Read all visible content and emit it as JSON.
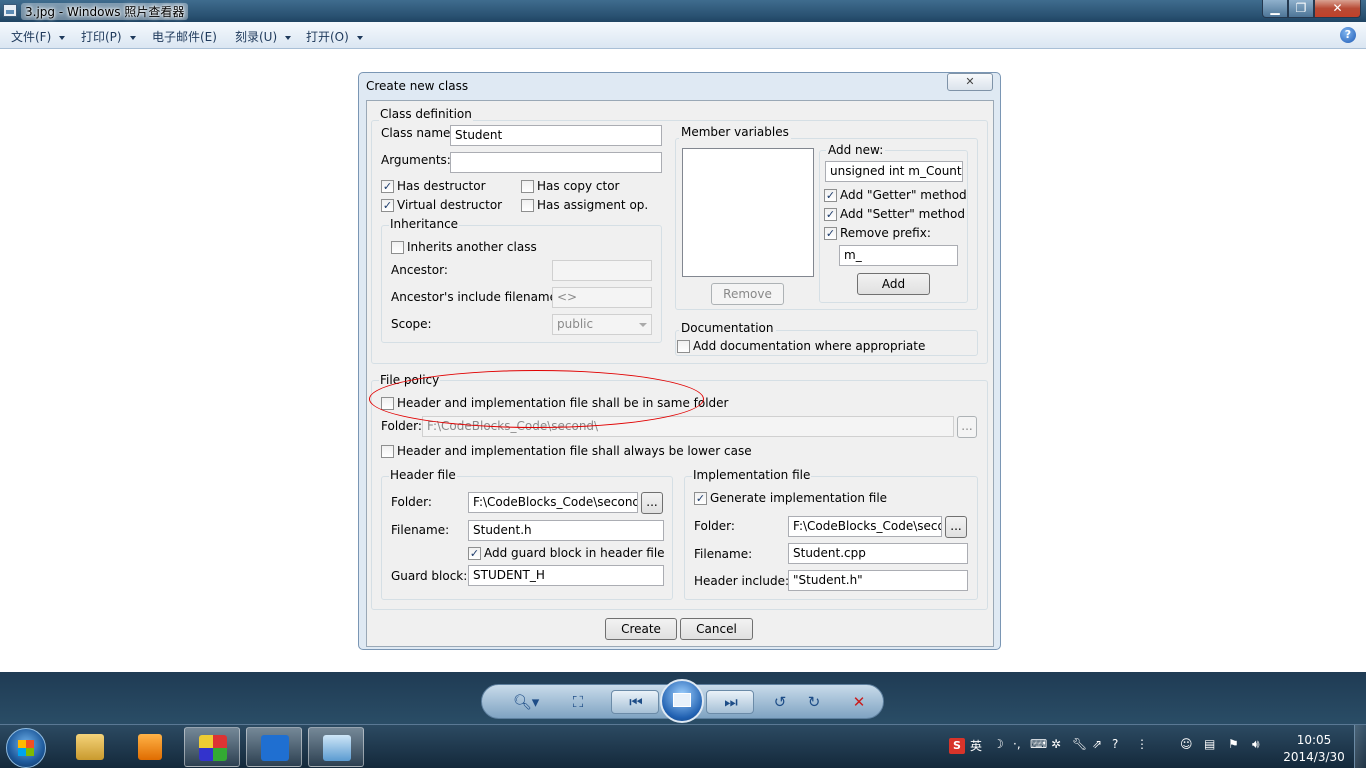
{
  "window": {
    "title": "3.jpg - Windows 照片查看器"
  },
  "menu": [
    {
      "label": "文件(F)",
      "arrow": true
    },
    {
      "label": "打印(P)",
      "arrow": true
    },
    {
      "label": "电子邮件(E)",
      "arrow": false
    },
    {
      "label": "刻录(U)",
      "arrow": true
    },
    {
      "label": "打开(O)",
      "arrow": true
    }
  ],
  "help": "?",
  "dialog": {
    "title": "Create new class",
    "close": "✕",
    "class_def": {
      "group": "Class definition",
      "class_name_label": "Class name:",
      "class_name_value": "Student",
      "arguments_label": "Arguments:",
      "arguments_value": "",
      "has_destructor": "Has destructor",
      "has_destructor_checked": true,
      "virtual_destructor": "Virtual destructor",
      "virtual_destructor_checked": true,
      "has_copy_ctor": "Has copy ctor",
      "has_copy_ctor_checked": false,
      "has_assign_op": "Has assigment op.",
      "has_assign_op_checked": false
    },
    "inheritance": {
      "group": "Inheritance",
      "inherits": "Inherits another class",
      "ancestor_label": "Ancestor:",
      "ancestor_value": "",
      "include_label": "Ancestor's include filename:",
      "include_value": "<>",
      "scope_label": "Scope:",
      "scope_value": "public"
    },
    "members": {
      "group": "Member variables",
      "add_new": "Add new:",
      "new_value": "unsigned int m_Counter",
      "getter": "Add \"Getter\" method",
      "setter": "Add \"Setter\" method",
      "remove_prefix": "Remove prefix:",
      "prefix_value": "m_",
      "remove_button": "Remove",
      "add_button": "Add"
    },
    "documentation": {
      "group": "Documentation",
      "add_doc": "Add documentation where appropriate"
    },
    "file_policy": {
      "group": "File policy",
      "same_folder": "Header and implementation file shall be in same folder",
      "folder_label": "Folder:",
      "folder_value": "F:\\CodeBlocks_Code\\second\\",
      "lower_case": "Header and implementation file shall always be lower case",
      "browse": "..."
    },
    "header_file": {
      "group": "Header file",
      "folder_label": "Folder:",
      "folder_value": "F:\\CodeBlocks_Code\\second\\ir",
      "filename_label": "Filename:",
      "filename_value": "Student.h",
      "guard_check": "Add guard block in header file",
      "guard_label": "Guard block:",
      "guard_value": "STUDENT_H"
    },
    "impl_file": {
      "group": "Implementation file",
      "generate": "Generate implementation file",
      "folder_label": "Folder:",
      "folder_value": "F:\\CodeBlocks_Code\\secon",
      "filename_label": "Filename:",
      "filename_value": "Student.cpp",
      "header_label": "Header include:",
      "header_value": "\"Student.h\""
    },
    "create_button": "Create",
    "cancel_button": "Cancel"
  },
  "tray": {
    "ime": "英",
    "time": "10:05",
    "date": "2014/3/30"
  }
}
